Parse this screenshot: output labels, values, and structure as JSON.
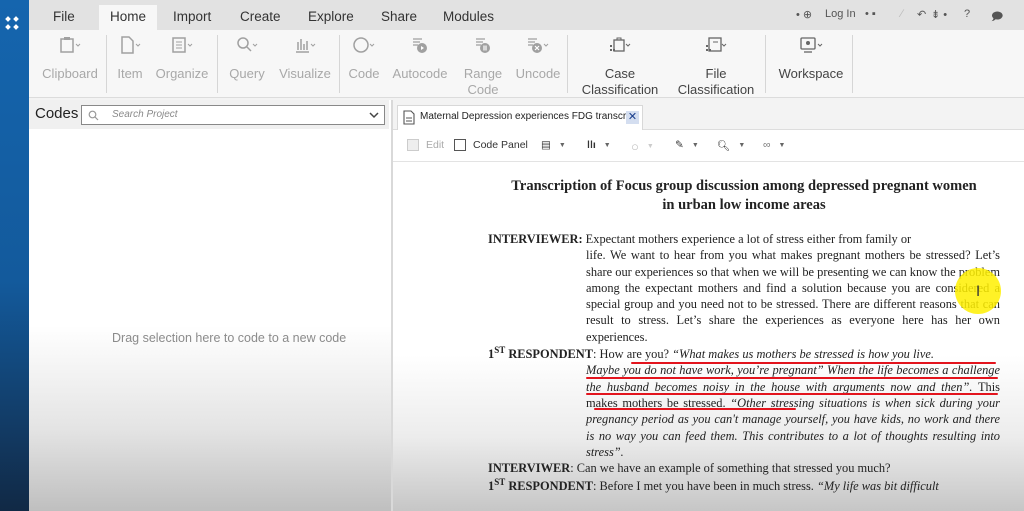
{
  "app": {
    "menu_tabs": [
      "File",
      "Home",
      "Import",
      "Create",
      "Explore",
      "Share",
      "Modules"
    ],
    "active_tab": "Home",
    "quick_access": {
      "login_label": "Log In",
      "help_label": "?"
    }
  },
  "ribbon": {
    "groups": [
      {
        "name": "clipboard",
        "buttons": [
          {
            "label": "Clipboard",
            "icon": "clipboard-icon"
          }
        ]
      },
      {
        "name": "item",
        "buttons": [
          {
            "label": "Item",
            "icon": "document-icon"
          },
          {
            "label": "Organize",
            "icon": "organize-icon"
          }
        ]
      },
      {
        "name": "query",
        "buttons": [
          {
            "label": "Query",
            "icon": "magnifier-icon"
          },
          {
            "label": "Visualize",
            "icon": "chart-icon"
          }
        ]
      },
      {
        "name": "coding",
        "buttons": [
          {
            "label": "Code",
            "icon": "circle-icon"
          },
          {
            "label": "Autocode",
            "icon": "autocode-icon"
          },
          {
            "label": "Range Code",
            "icon": "range-code-icon"
          },
          {
            "label": "Uncode",
            "icon": "uncode-icon"
          }
        ]
      },
      {
        "name": "classification",
        "buttons": [
          {
            "label": "Case Classification",
            "icon": "case-classification-icon"
          },
          {
            "label": "File Classification",
            "icon": "file-classification-icon"
          }
        ]
      },
      {
        "name": "workspace",
        "buttons": [
          {
            "label": "Workspace",
            "icon": "workspace-icon"
          }
        ]
      }
    ]
  },
  "codes_panel": {
    "title": "Codes",
    "search_placeholder": "Search Project",
    "empty_hint": "Drag selection here to code to a new code"
  },
  "document": {
    "tab_label": "Maternal Depression experiences FDG transcri",
    "toolbar": {
      "edit_label": "Edit",
      "code_panel_label": "Code Panel"
    },
    "title_line1": "Transcription of Focus group discussion among depressed pregnant women",
    "title_line2": "in urban low income areas",
    "p1": {
      "speaker": "INTERVIEWER:",
      "first": " Expectant mothers experience a lot of stress either from family or",
      "rest": "life. We want to hear from you what makes pregnant mothers be stressed? Let’s share our experiences so that when we will be presenting we can know the problem among the expectant mothers and find a solution because you are considered a special group and you need not to be stressed. There are different reasons that can result to stress. Let’s share the experiences as everyone here has her own experiences."
    },
    "p2": {
      "ordinal": "1",
      "ordinal_sup": "ST",
      "speaker": " RESPONDENT",
      "first_plain": ": How are you? ",
      "first_italic": "“What makes us mothers be stressed is how you live.",
      "rest_italic_1": "Maybe you do not have work, you’re pregnant” When the life becomes a challenge the husband becomes noisy in the house with arguments now and then”.",
      "rest_plain": " This makes mothers be stressed.",
      "rest_italic_2": " “Other stressing situations is when sick during your pregnancy period as you can't manage yourself, you have kids, no work and there is no way you can feed them. This contributes to a lot of thoughts resulting into stress”."
    },
    "p3": {
      "speaker": "INTERVIWER",
      "text": ": Can we have an example of something that stressed you much?"
    },
    "p4": {
      "ordinal": "1",
      "ordinal_sup": "ST",
      "speaker": " RESPONDENT",
      "plain": ": Before I met you have been in much stress. ",
      "italic": "“My life was bit difficult"
    }
  },
  "colors": {
    "annotation_underline": "#e3141d",
    "cursor_highlight": "#fff000",
    "brand_sidebar": "#1565ae"
  }
}
